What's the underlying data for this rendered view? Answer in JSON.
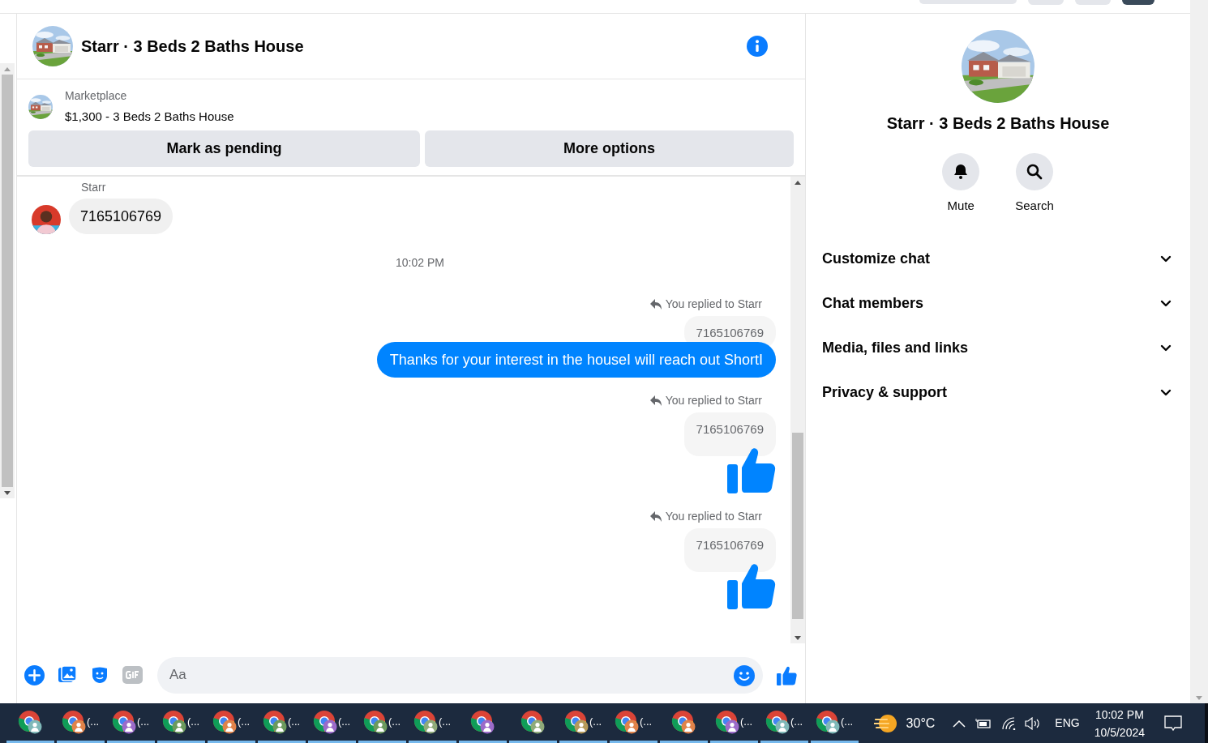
{
  "conversation": {
    "title": "Starr · 3 Beds 2 Baths House"
  },
  "listing": {
    "source": "Marketplace",
    "summary": "$1,300 - 3 Beds 2 Baths House"
  },
  "actions": [
    "Mark as pending",
    "More options"
  ],
  "messages": [
    {
      "kind": "incoming",
      "sender": "Starr",
      "text": "7165106769"
    },
    {
      "kind": "timestamp",
      "text": "10:02 PM"
    },
    {
      "kind": "reply",
      "reply_label": "You replied to Starr",
      "quoted": "7165106769",
      "text": "Thanks for your interest in the houseI will reach out ShortI"
    },
    {
      "kind": "reply_like",
      "reply_label": "You replied to Starr",
      "quoted": "7165106769"
    },
    {
      "kind": "reply_like",
      "reply_label": "You replied to Starr",
      "quoted": "7165106769"
    }
  ],
  "composer": {
    "placeholder": "Aa"
  },
  "details": {
    "title": "Starr · 3 Beds 2 Baths House",
    "quick_actions": [
      {
        "kind": "bell",
        "label": "Mute"
      },
      {
        "kind": "search",
        "label": "Search"
      }
    ],
    "sections": [
      {
        "label": "Customize chat",
        "expanded": false
      },
      {
        "label": "Chat members",
        "expanded": false
      },
      {
        "label": "Media, files and links",
        "expanded": false
      },
      {
        "label": "Privacy & support",
        "expanded": false
      }
    ]
  },
  "taskbar": {
    "apps": [
      {
        "color": "#7fb8b8"
      },
      {
        "label": "(...",
        "color": "#e0834a"
      },
      {
        "label": "(...",
        "color": "#9b6bc9"
      },
      {
        "label": "(...",
        "color": "#6c9a5e"
      },
      {
        "label": "(...",
        "color": "#e0834a"
      },
      {
        "label": "(...",
        "color": "#6c9a5e"
      },
      {
        "label": "(...",
        "color": "#9b6bc9"
      },
      {
        "label": "(...",
        "color": "#6c9a5e"
      },
      {
        "label": "(...",
        "color": "#8faa7a"
      },
      {
        "color": "#9b6bc9"
      },
      {
        "color": "#8faa7a"
      },
      {
        "label": "(...",
        "color": "#b59a5a"
      },
      {
        "label": "(...",
        "color": "#e0834a"
      },
      {
        "color": "#e0834a"
      },
      {
        "label": "(...",
        "color": "#9b6bc9"
      },
      {
        "label": "(...",
        "color": "#7fb8b8"
      },
      {
        "label": "(...",
        "color": "#7fb8b8"
      }
    ],
    "temperature": "30°C",
    "language": "ENG",
    "time": "10:02 PM",
    "date": "10/5/2024"
  }
}
